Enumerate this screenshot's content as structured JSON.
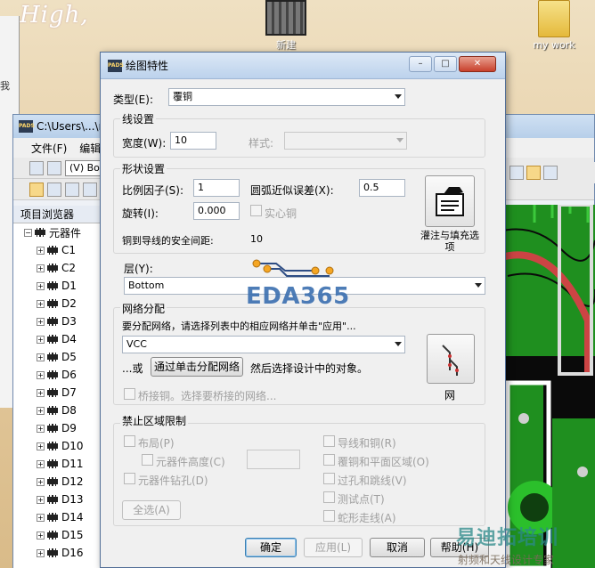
{
  "desktop": {
    "wallpaper_text": "High,",
    "icons": [
      {
        "label": "新建"
      },
      {
        "label": "my work"
      }
    ],
    "left_strip_char": "我"
  },
  "pads_window": {
    "title": "C:\\Users\\...\\r",
    "logo_text": "PADS",
    "menu": [
      "文件(F)",
      "编辑"
    ],
    "toolbar_combo": "(V) Bo",
    "browser_title": "项目浏览器",
    "tree_root": "元器件",
    "tree_items": [
      "C1",
      "C2",
      "D1",
      "D2",
      "D3",
      "D4",
      "D5",
      "D6",
      "D7",
      "D8",
      "D9",
      "D10",
      "D11",
      "D12",
      "D13",
      "D14",
      "D15",
      "D16"
    ]
  },
  "dialog": {
    "title": "绘图特性",
    "logo_text": "PADS",
    "window_buttons": {
      "min": "–",
      "max": "□",
      "close": "✕"
    },
    "type_label": "类型(E):",
    "type_value": "覆铜",
    "line_group": {
      "title": "线设置",
      "width_label": "宽度(W):",
      "width_value": "10",
      "style_label": "样式:",
      "style_value": ""
    },
    "shape_group": {
      "title": "形状设置",
      "scale_label": "比例因子(S):",
      "scale_value": "1",
      "arc_label": "圆弧近似误差(X):",
      "arc_value": "0.5",
      "rotate_label": "旋转(I):",
      "rotate_value": "0.000",
      "solid_label": "实心铜",
      "clearance_label": "铜到导线的安全间距:",
      "clearance_value": "10",
      "flood_label": "灌注与填充选项"
    },
    "layer_label": "层(Y):",
    "layer_value": "Bottom",
    "net_group": {
      "title": "网络分配",
      "hint": "要分配网络，请选择列表中的相应网络并单击\"应用\"...",
      "net_value": "VCC",
      "or_text": "...或",
      "assign_button": "通过单击分配网络",
      "then_text": "然后选择设计中的对象。",
      "bridge_label": "桥接铜。选择要桥接的网络...",
      "net_icon_label": "网"
    },
    "keepout_group": {
      "title": "禁止区域限制",
      "placement": "布局(P)",
      "component_height": "元器件高度(C)",
      "component_drill": "元器件钻孔(D)",
      "select_all": "全选(A)",
      "traces_copper": "导线和铜(R)",
      "copper_planes": "覆铜和平面区域(O)",
      "vias_jumpers": "过孔和跳线(V)",
      "test_points": "测试点(T)",
      "serpentine": "蛇形走线(A)"
    },
    "buttons": {
      "ok": "确定",
      "apply": "应用(L)",
      "cancel": "取消",
      "help": "帮助(H)"
    }
  },
  "watermark": {
    "brand": "EDA365",
    "bottom": "易迪拓培训",
    "bottom_sub": "射频和天线设计专家"
  }
}
